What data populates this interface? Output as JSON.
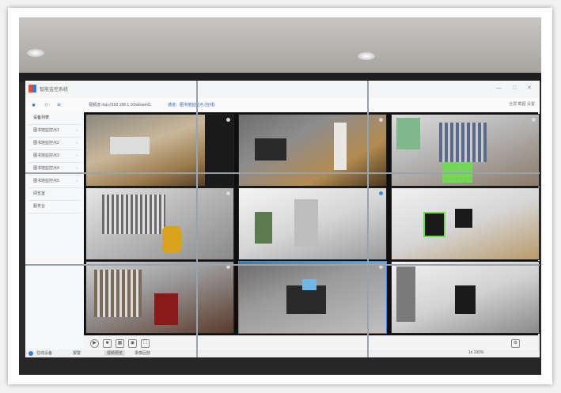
{
  "app": {
    "title": "智能监控系统",
    "window_controls": "— □ ✕"
  },
  "toolbar": {
    "url": "视频流 rtsp://192.168.1.10/stream/1",
    "channel_link": "通道：图书馆监控点 (在线)",
    "right_tools": "全屏  截图  设置"
  },
  "sidebar": {
    "section_title": "设备列表",
    "items": [
      {
        "label": "图书馆监控点1"
      },
      {
        "label": "图书馆监控点2"
      },
      {
        "label": "图书馆监控点3"
      },
      {
        "label": "图书馆监控点4"
      },
      {
        "label": "图书馆监控点5"
      },
      {
        "label": "阅览室"
      },
      {
        "label": "服务台"
      }
    ]
  },
  "cameras": [
    {
      "stamp": "",
      "wm": ""
    },
    {
      "stamp": "",
      "wm": ""
    },
    {
      "stamp": "",
      "wm": ""
    },
    {
      "stamp": "",
      "wm": ""
    },
    {
      "stamp": "",
      "wm": ""
    },
    {
      "stamp": "",
      "wm": ""
    },
    {
      "stamp": "",
      "wm": ""
    },
    {
      "stamp": "",
      "wm": ""
    },
    {
      "stamp": "",
      "wm": ""
    }
  ],
  "status": {
    "left": "在线设备",
    "middle": "报警",
    "tab": "视频预览",
    "tab2": "录像回放",
    "right": "1x  100%"
  },
  "colors": {
    "accent": "#3a7bd5",
    "motion_highlight": "#6fdc4f"
  },
  "icons": [
    "user-icon",
    "search-icon",
    "menu-icon",
    "play-icon",
    "stop-icon",
    "grid-icon",
    "fullscreen-icon",
    "camera-icon",
    "settings-icon"
  ]
}
